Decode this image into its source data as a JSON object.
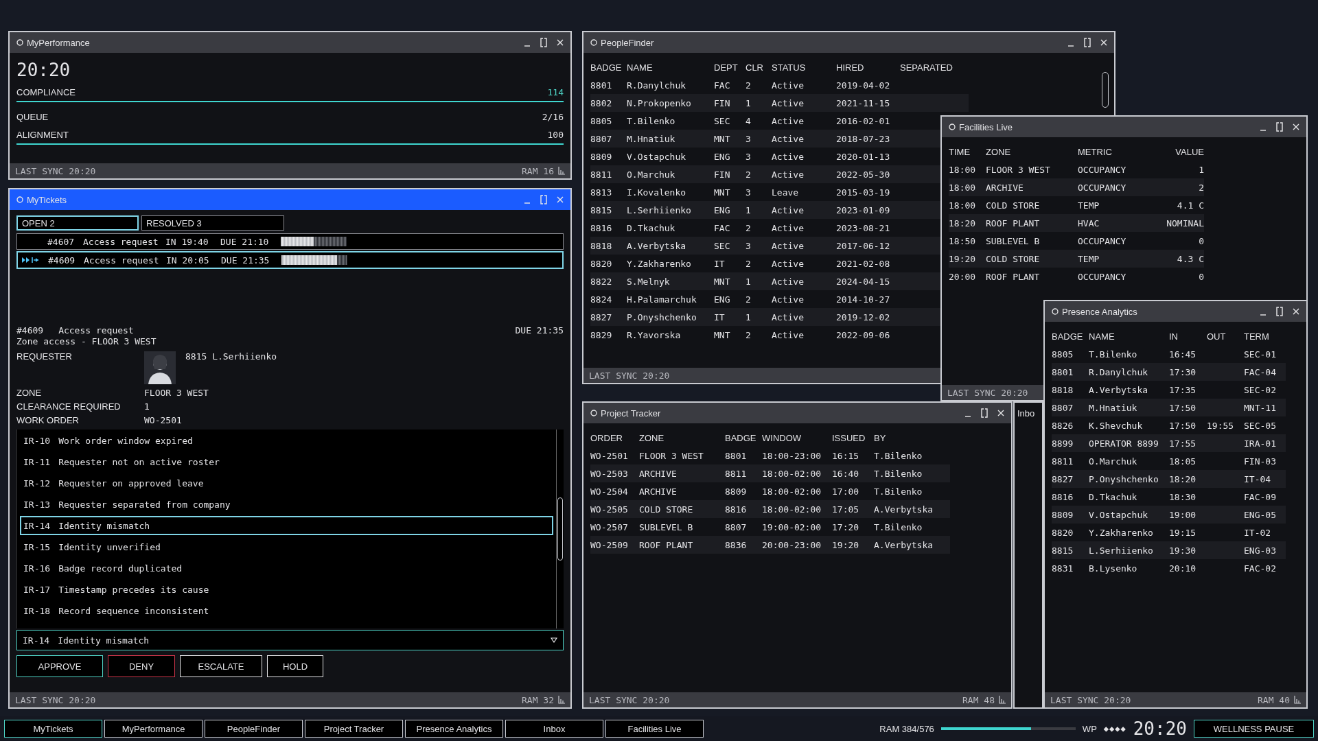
{
  "desktop": {
    "windows": [
      {
        "kind": "performance",
        "title": "MyPerformance",
        "active": false,
        "clock": "20:20",
        "metrics": [
          {
            "label": "COMPLIANCE",
            "value": "114",
            "accent": true,
            "kind": "bar"
          },
          {
            "label": "QUEUE",
            "value": "2/16",
            "accent": false,
            "kind": "plain"
          },
          {
            "label": "ALIGNMENT",
            "value": "100",
            "accent": false,
            "kind": "bar"
          }
        ],
        "sync": "LAST SYNC 20:20",
        "ram": "RAM 16"
      },
      {
        "kind": "tickets",
        "title": "MyTickets",
        "active": true,
        "tabs": [
          {
            "label": "OPEN 2",
            "selected": true
          },
          {
            "label": "RESOLVED 3",
            "selected": false
          }
        ],
        "tickets": [
          {
            "id": "#4607",
            "type": "Access request",
            "in": "IN 19:40",
            "due": "DUE 21:10",
            "level": 0.5,
            "selected": false
          },
          {
            "id": "#4609",
            "type": "Access request",
            "in": "IN 20:05",
            "due": "DUE 21:35",
            "level": 0.84,
            "selected": true
          }
        ],
        "detail": {
          "id": "#4609",
          "type": "Access request",
          "due": "DUE 21:35",
          "subtitle": "Zone access - FLOOR 3 WEST",
          "fields": [
            {
              "label": "REQUESTER",
              "value": "8815 L.Serhiienko",
              "kind": "person"
            },
            {
              "label": "ZONE",
              "value": "FLOOR 3 WEST",
              "kind": "text"
            },
            {
              "label": "CLEARANCE REQUIRED",
              "value": "1",
              "kind": "text"
            },
            {
              "label": "WORK ORDER",
              "value": "WO-2501",
              "kind": "text"
            }
          ]
        },
        "reason_options": [
          {
            "code": "IR-10",
            "text": "Work order window expired",
            "selected": false
          },
          {
            "code": "IR-11",
            "text": "Requester not on active roster",
            "selected": false
          },
          {
            "code": "IR-12",
            "text": "Requester on approved leave",
            "selected": false
          },
          {
            "code": "IR-13",
            "text": "Requester separated from company",
            "selected": false
          },
          {
            "code": "IR-14",
            "text": "Identity mismatch",
            "selected": true
          },
          {
            "code": "IR-15",
            "text": "Identity unverified",
            "selected": false
          },
          {
            "code": "IR-16",
            "text": "Badge record duplicated",
            "selected": false
          },
          {
            "code": "IR-17",
            "text": "Timestamp precedes its cause",
            "selected": false
          },
          {
            "code": "IR-18",
            "text": "Record sequence inconsistent",
            "selected": false
          }
        ],
        "reason_select": {
          "code": "IR-14",
          "text": "Identity mismatch"
        },
        "buttons": [
          {
            "label": "APPROVE",
            "kind": "approve"
          },
          {
            "label": "DENY",
            "kind": "deny"
          },
          {
            "label": "ESCALATE",
            "kind": "neutral"
          },
          {
            "label": "HOLD",
            "kind": "neutral"
          }
        ],
        "sync": "LAST SYNC 20:20",
        "ram": "RAM 32"
      },
      {
        "kind": "table",
        "title": "PeopleFinder",
        "active": false,
        "columns": [
          "BADGE",
          "NAME",
          "DEPT",
          "CLR",
          "STATUS",
          "HIRED",
          "SEPARATED"
        ],
        "rows": [
          [
            "8801",
            "R.Danylchuk",
            "FAC",
            "2",
            "Active",
            "2019-04-02"
          ],
          [
            "8802",
            "N.Prokopenko",
            "FIN",
            "1",
            "Active",
            "2021-11-15"
          ],
          [
            "8805",
            "T.Bilenko",
            "SEC",
            "4",
            "Active",
            "2016-02-01"
          ],
          [
            "8807",
            "M.Hnatiuk",
            "MNT",
            "3",
            "Active",
            "2018-07-23"
          ],
          [
            "8809",
            "V.Ostapchuk",
            "ENG",
            "3",
            "Active",
            "2020-01-13"
          ],
          [
            "8811",
            "O.Marchuk",
            "FIN",
            "2",
            "Active",
            "2022-05-30"
          ],
          [
            "8813",
            "I.Kovalenko",
            "MNT",
            "3",
            "Leave",
            "2015-03-19"
          ],
          [
            "8815",
            "L.Serhiienko",
            "ENG",
            "1",
            "Active",
            "2023-01-09"
          ],
          [
            "8816",
            "D.Tkachuk",
            "FAC",
            "2",
            "Active",
            "2023-08-21"
          ],
          [
            "8818",
            "A.Verbytska",
            "SEC",
            "3",
            "Active",
            "2017-06-12"
          ],
          [
            "8820",
            "Y.Zakharenko",
            "IT",
            "2",
            "Active",
            "2021-02-08"
          ],
          [
            "8822",
            "S.Melnyk",
            "MNT",
            "1",
            "Active",
            "2024-04-15"
          ],
          [
            "8824",
            "H.Palamarchuk",
            "ENG",
            "2",
            "Active",
            "2014-10-27"
          ],
          [
            "8827",
            "P.Onyshchenko",
            "IT",
            "1",
            "Active",
            "2019-12-02"
          ],
          [
            "8829",
            "R.Yavorska",
            "MNT",
            "2",
            "Active",
            "2022-09-06"
          ]
        ],
        "sync": "LAST SYNC 20:20"
      },
      {
        "kind": "table",
        "title": "Project Tracker",
        "active": false,
        "columns": [
          "ORDER",
          "ZONE",
          "BADGE",
          "WINDOW",
          "ISSUED",
          "BY"
        ],
        "rows": [
          [
            "WO-2501",
            "FLOOR 3 WEST",
            "8801",
            "18:00-23:00",
            "16:15",
            "T.Bilenko"
          ],
          [
            "WO-2503",
            "ARCHIVE",
            "8811",
            "18:00-02:00",
            "16:40",
            "T.Bilenko"
          ],
          [
            "WO-2504",
            "ARCHIVE",
            "8809",
            "18:00-02:00",
            "17:00",
            "T.Bilenko"
          ],
          [
            "WO-2505",
            "COLD STORE",
            "8816",
            "18:00-02:00",
            "17:05",
            "A.Verbytska"
          ],
          [
            "WO-2507",
            "SUBLEVEL B",
            "8807",
            "19:00-02:00",
            "17:20",
            "T.Bilenko"
          ],
          [
            "WO-2509",
            "ROOF PLANT",
            "8836",
            "20:00-23:00",
            "19:20",
            "A.Verbytska"
          ]
        ],
        "sync": "LAST SYNC 20:20",
        "ram": "RAM 48"
      },
      {
        "kind": "inbox",
        "title": "Inbo",
        "active": false
      },
      {
        "kind": "table",
        "title": "Facilities Live",
        "active": false,
        "columns": [
          "TIME",
          "ZONE",
          "METRIC",
          "VALUE"
        ],
        "rows": [
          [
            "18:00",
            "FLOOR 3 WEST",
            "OCCUPANCY",
            "1"
          ],
          [
            "18:00",
            "ARCHIVE",
            "OCCUPANCY",
            "2"
          ],
          [
            "18:00",
            "COLD STORE",
            "TEMP",
            "4.1 C"
          ],
          [
            "18:20",
            "ROOF PLANT",
            "HVAC",
            "NOMINAL"
          ],
          [
            "18:50",
            "SUBLEVEL B",
            "OCCUPANCY",
            "0"
          ],
          [
            "19:20",
            "COLD STORE",
            "TEMP",
            "4.3 C"
          ],
          [
            "20:00",
            "ROOF PLANT",
            "OCCUPANCY",
            "0"
          ]
        ],
        "sync": "LAST SYNC 20:20"
      },
      {
        "kind": "table",
        "title": "Presence Analytics",
        "active": false,
        "columns": [
          "BADGE",
          "NAME",
          "IN",
          "OUT",
          "TERM"
        ],
        "rows": [
          [
            "8805",
            "T.Bilenko",
            "16:45",
            null,
            "SEC-01"
          ],
          [
            "8801",
            "R.Danylchuk",
            "17:30",
            null,
            "FAC-04"
          ],
          [
            "8818",
            "A.Verbytska",
            "17:35",
            null,
            "SEC-02"
          ],
          [
            "8807",
            "M.Hnatiuk",
            "17:50",
            null,
            "MNT-11"
          ],
          [
            "8826",
            "K.Shevchuk",
            "17:50",
            "19:55",
            "SEC-05"
          ],
          [
            "8899",
            "OPERATOR 8899",
            "17:55",
            null,
            "IRA-01"
          ],
          [
            "8811",
            "O.Marchuk",
            "18:05",
            null,
            "FIN-03"
          ],
          [
            "8827",
            "P.Onyshchenko",
            "18:20",
            null,
            "IT-04"
          ],
          [
            "8816",
            "D.Tkachuk",
            "18:30",
            null,
            "FAC-09"
          ],
          [
            "8809",
            "V.Ostapchuk",
            "19:00",
            null,
            "ENG-05"
          ],
          [
            "8820",
            "Y.Zakharenko",
            "19:15",
            null,
            "IT-02"
          ],
          [
            "8815",
            "L.Serhiienko",
            "19:30",
            null,
            "ENG-03"
          ],
          [
            "8831",
            "B.Lysenko",
            "20:10",
            null,
            "FAC-02"
          ]
        ],
        "sync": "LAST SYNC 20:20",
        "ram": "RAM 40"
      }
    ]
  },
  "taskbar": {
    "apps": [
      {
        "label": "MyTickets",
        "selected": true
      },
      {
        "label": "MyPerformance",
        "selected": false
      },
      {
        "label": "PeopleFinder",
        "selected": false
      },
      {
        "label": "Project Tracker",
        "selected": false
      },
      {
        "label": "Presence Analytics",
        "selected": false
      },
      {
        "label": "Inbox",
        "selected": false
      },
      {
        "label": "Facilities Live",
        "selected": false
      }
    ],
    "ram": {
      "label": "RAM 384/576",
      "level": 0.67
    },
    "wp": {
      "label": "WP",
      "marks": "◆◆◆◆"
    },
    "clock": "20:20",
    "pause_button": "WELLNESS PAUSE"
  }
}
